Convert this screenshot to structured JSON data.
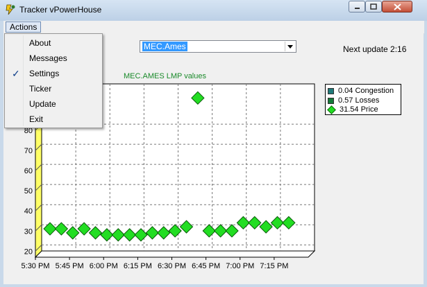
{
  "window": {
    "title": "Tracker vPowerHouse"
  },
  "menubar": {
    "actions_label": "Actions"
  },
  "menu": {
    "items": [
      {
        "label": "About",
        "checked": false
      },
      {
        "label": "Messages",
        "checked": false
      },
      {
        "label": "Settings",
        "checked": true
      },
      {
        "label": "Ticker",
        "checked": false
      },
      {
        "label": "Update",
        "checked": false
      },
      {
        "label": "Exit",
        "checked": false
      }
    ],
    "check_mark": "✓"
  },
  "controls": {
    "node_select": {
      "value": "MEC.Ames"
    },
    "next_update": "Next update 2:16"
  },
  "colors": {
    "congestion": "#1f7a7a",
    "losses": "#157a3a",
    "price": "#22dd22",
    "plot_wall": "#ffff66",
    "title": "#1a8a2a"
  },
  "chart_data": {
    "type": "scatter",
    "title": "MEC.AMES LMP values",
    "xlabel": "",
    "ylabel": "",
    "x_ticks": [
      "5:30 PM",
      "5:45 PM",
      "6:00 PM",
      "6:15 PM",
      "6:30 PM",
      "6:45 PM",
      "7:00 PM",
      "7:15 PM"
    ],
    "y_ticks": [
      20,
      30,
      40,
      50,
      60,
      70,
      80
    ],
    "ylim": [
      17,
      100
    ],
    "grid": true,
    "legend_placement": "right",
    "legend": [
      {
        "label": "0.04 Congestion",
        "marker": "square",
        "color": "#1f7a7a"
      },
      {
        "label": "0.57 Losses",
        "marker": "square",
        "color": "#157a3a"
      },
      {
        "label": "31.54 Price",
        "marker": "diamond",
        "color": "#22dd22"
      }
    ],
    "series": [
      {
        "name": "31.54 Price",
        "x": [
          "5:30 PM",
          "5:35 PM",
          "5:40 PM",
          "5:45 PM",
          "5:50 PM",
          "5:55 PM",
          "6:00 PM",
          "6:05 PM",
          "6:10 PM",
          "6:15 PM",
          "6:20 PM",
          "6:25 PM",
          "6:30 PM",
          "6:35 PM",
          "6:40 PM",
          "6:45 PM",
          "6:50 PM",
          "6:55 PM",
          "7:00 PM",
          "7:05 PM",
          "7:10 PM",
          "7:15 PM"
        ],
        "y": [
          28,
          28,
          26,
          28,
          26,
          25,
          25,
          25,
          25,
          26,
          26,
          27,
          29,
          93,
          27,
          27,
          27,
          31,
          31,
          29,
          31,
          31
        ]
      }
    ]
  }
}
